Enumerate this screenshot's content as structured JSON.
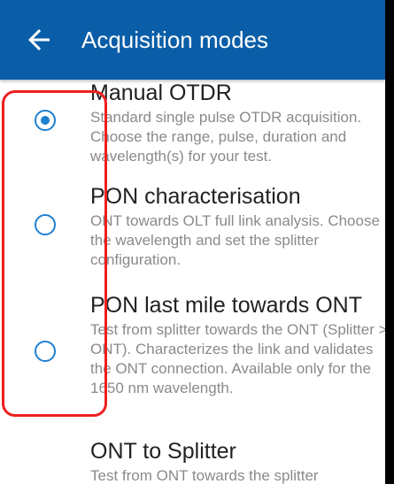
{
  "appbar": {
    "title": "Acquisition modes",
    "back_icon": "arrow-left-icon",
    "background": "#0a5ea8"
  },
  "options": [
    {
      "title": "Manual OTDR",
      "description": "Standard single pulse OTDR acquisition. Choose the range, pulse, duration and wavelength(s) for your test.",
      "selected": true
    },
    {
      "title": "PON characterisation",
      "description": "ONT towards OLT full link analysis. Choose the wavelength and set the splitter configuration.",
      "selected": false
    },
    {
      "title": "PON last mile towards ONT",
      "description": "Test from splitter towards the ONT (Splitter > ONT). Characterizes the link and validates the ONT connection. Available only for the 1650 nm wavelength.",
      "selected": false
    },
    {
      "title": "ONT to Splitter",
      "description": "Test from ONT towards the splitter",
      "selected": false
    }
  ],
  "colors": {
    "radio": "#1f7fd1",
    "annotation": "#ef1f1f"
  }
}
